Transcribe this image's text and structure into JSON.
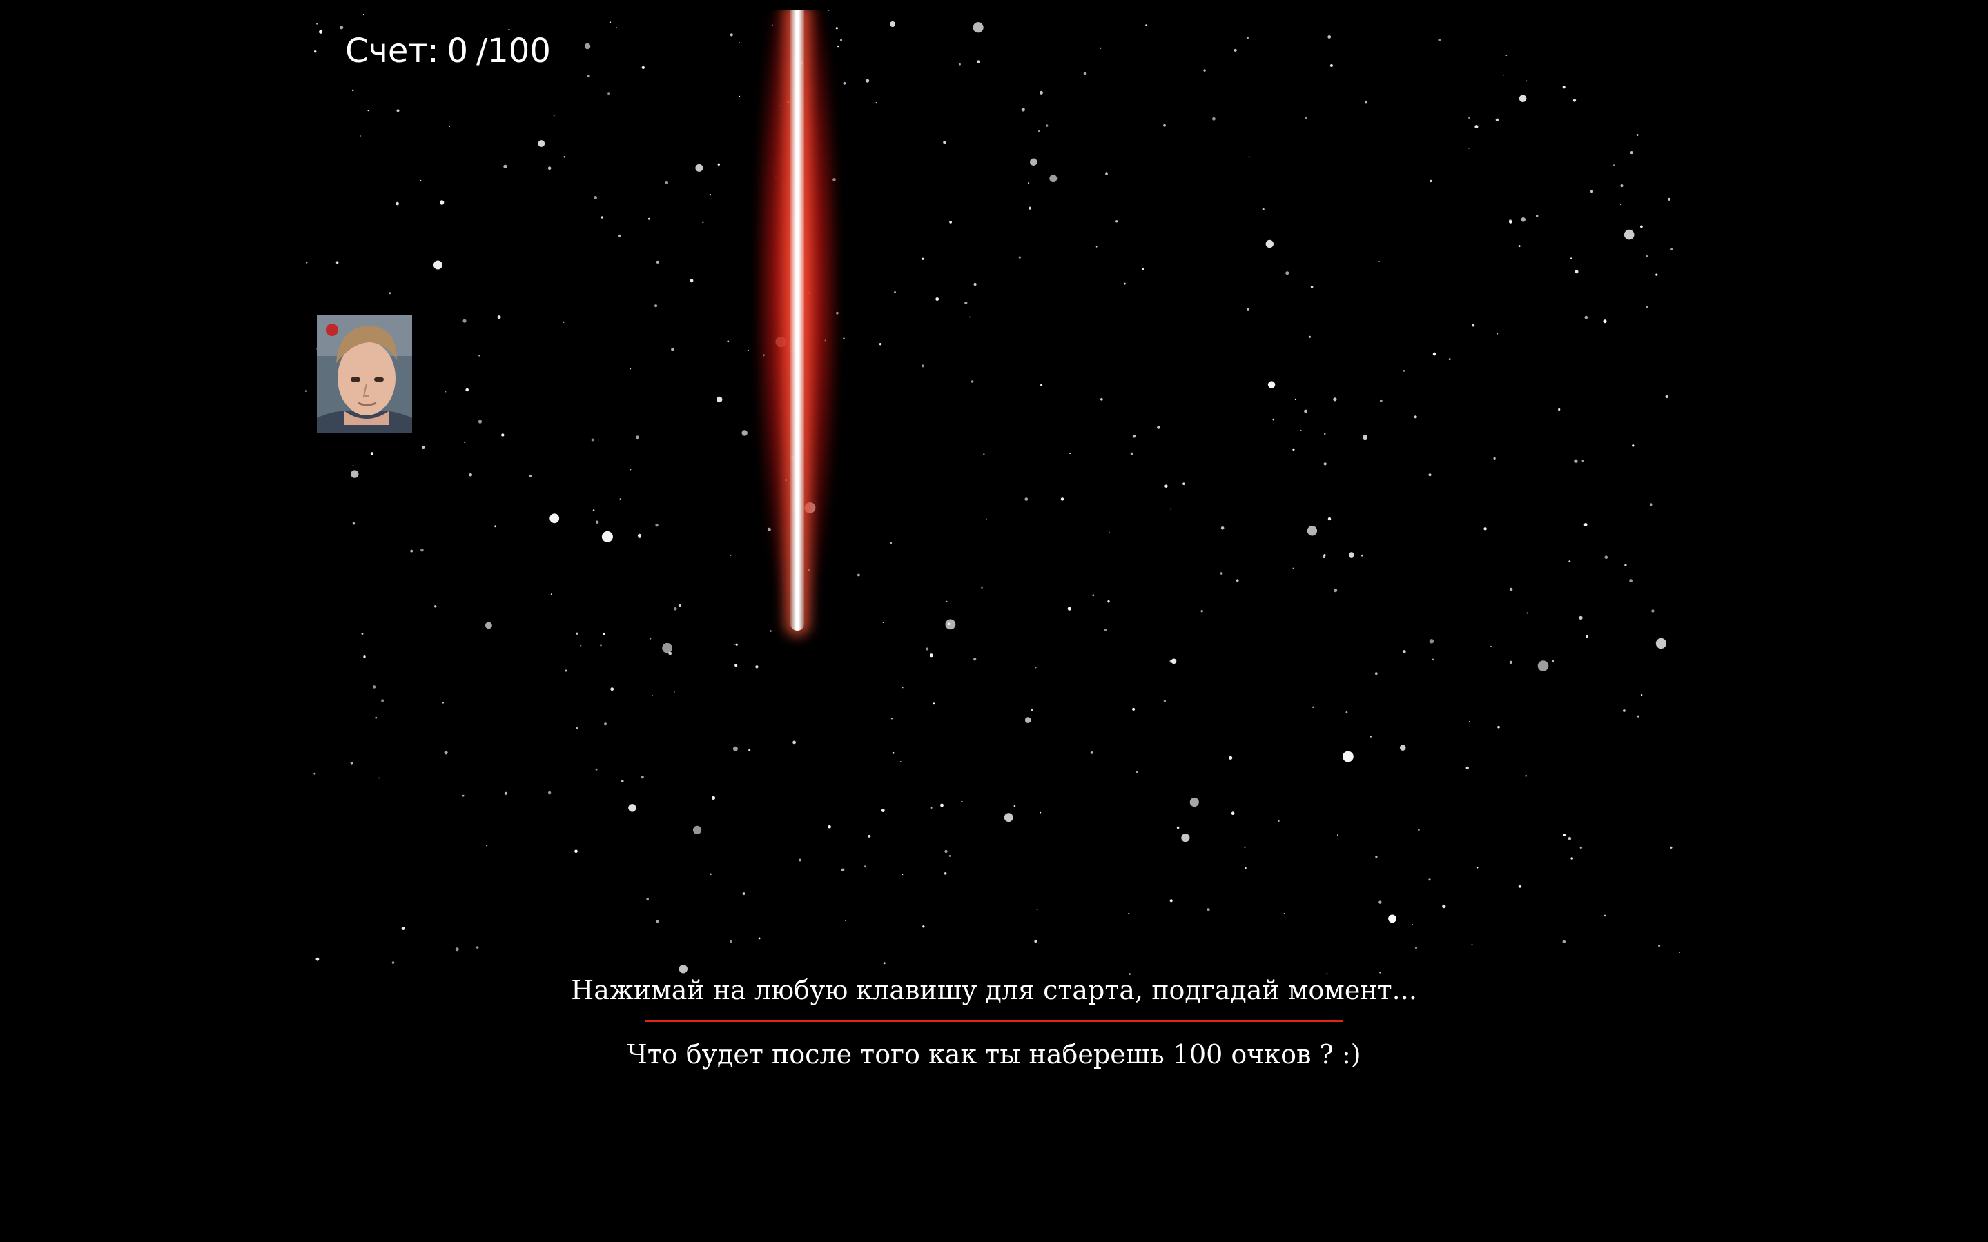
{
  "score": {
    "label": "Счет:",
    "value": "0",
    "target": "/100"
  },
  "player": {
    "icon": "player-avatar-photo"
  },
  "obstacle": {
    "icon": "red-laser-beam",
    "color": "#d8261c"
  },
  "instructions": {
    "start_hint": "Нажимай на любую клавишу для старта, подгадай момент...",
    "question": "Что будет после того как ты наберешь 100 очков ? :)"
  },
  "colors": {
    "background": "#000000",
    "divider": "#e0261a",
    "text": "#ffffff"
  }
}
